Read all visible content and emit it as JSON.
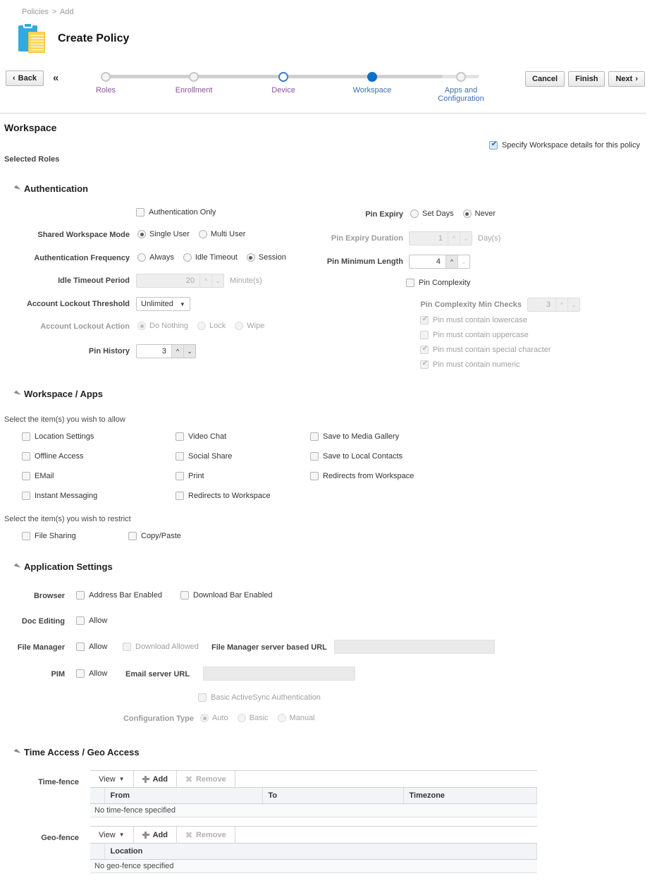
{
  "breadcrumb": {
    "root": "Policies",
    "separator": ">",
    "current": "Add"
  },
  "header": {
    "title": "Create Policy",
    "icon": "clipboard-document-icon"
  },
  "toolbar": {
    "back_label": "Back",
    "back_chevron": "‹",
    "collapse_icon": "«",
    "cancel_label": "Cancel",
    "finish_label": "Finish",
    "next_label": "Next",
    "next_chevron": "›"
  },
  "wizard": {
    "steps": [
      {
        "label": "Roles",
        "state": "done"
      },
      {
        "label": "Enrollment",
        "state": "done"
      },
      {
        "label": "Device",
        "state": "current"
      },
      {
        "label": "Workspace",
        "state": "active"
      },
      {
        "label": "Apps and\nConfiguration",
        "label_line1": "Apps and",
        "label_line2": "Configuration",
        "state": "todo"
      }
    ]
  },
  "page": {
    "section_title": "Workspace",
    "specify_label": "Specify Workspace details for this policy",
    "specify_checked": true,
    "selected_roles_label": "Selected Roles"
  },
  "authentication": {
    "heading": "Authentication",
    "auth_only": {
      "label": "Authentication Only",
      "checked": false
    },
    "shared_workspace_mode": {
      "label": "Shared Workspace Mode",
      "options": [
        "Single User",
        "Multi User"
      ],
      "selected": "Single User"
    },
    "auth_frequency": {
      "label": "Authentication Frequency",
      "options": [
        "Always",
        "Idle Timeout",
        "Session"
      ],
      "selected": "Session"
    },
    "idle_timeout_period": {
      "label": "Idle Timeout Period",
      "value": "20",
      "unit": "Minute(s)",
      "disabled": true
    },
    "account_lockout_threshold": {
      "label": "Account Lockout Threshold",
      "value": "Unlimited",
      "options": [
        "Unlimited"
      ]
    },
    "account_lockout_action": {
      "label": "Account Lockout Action",
      "options": [
        "Do Nothing",
        "Lock",
        "Wipe"
      ],
      "selected": "Do Nothing",
      "disabled": true
    },
    "pin_history": {
      "label": "Pin History",
      "value": "3"
    },
    "pin_expiry": {
      "label": "Pin Expiry",
      "options": [
        "Set Days",
        "Never"
      ],
      "selected": "Never"
    },
    "pin_expiry_duration": {
      "label": "Pin Expiry Duration",
      "value": "1",
      "unit": "Day(s)",
      "disabled": true
    },
    "pin_minimum_length": {
      "label": "Pin Minimum Length",
      "value": "4"
    },
    "pin_complexity": {
      "label": "Pin Complexity",
      "checked": false
    },
    "pin_complexity_min_checks": {
      "label": "Pin Complexity Min Checks",
      "value": "3",
      "disabled": true
    },
    "pin_rules": [
      {
        "label": "Pin must contain lowercase",
        "checked": true,
        "disabled": true
      },
      {
        "label": "Pin must contain uppercase",
        "checked": false,
        "disabled": true
      },
      {
        "label": "Pin must contain special character",
        "checked": true,
        "disabled": true
      },
      {
        "label": "Pin must contain numeric",
        "checked": true,
        "disabled": true
      }
    ]
  },
  "workspace_apps": {
    "heading": "Workspace / Apps",
    "allow_hint": "Select the item(s) you wish to allow",
    "allow_items": [
      {
        "label": "Location Settings",
        "checked": false
      },
      {
        "label": "Offline Access",
        "checked": false
      },
      {
        "label": "EMail",
        "checked": false
      },
      {
        "label": "Instant Messaging",
        "checked": false
      },
      {
        "label": "Video Chat",
        "checked": false
      },
      {
        "label": "Social Share",
        "checked": false
      },
      {
        "label": "Print",
        "checked": false
      },
      {
        "label": "Redirects to Workspace",
        "checked": false
      },
      {
        "label": "Save to Media Gallery",
        "checked": false
      },
      {
        "label": "Save to Local Contacts",
        "checked": false
      },
      {
        "label": "Redirects from Workspace",
        "checked": false
      }
    ],
    "restrict_hint": "Select the item(s) you wish to restrict",
    "restrict_items": [
      {
        "label": "File Sharing",
        "checked": false
      },
      {
        "label": "Copy/Paste",
        "checked": false
      }
    ]
  },
  "application_settings": {
    "heading": "Application Settings",
    "browser": {
      "label": "Browser",
      "address_bar": {
        "label": "Address Bar Enabled",
        "checked": false
      },
      "download_bar": {
        "label": "Download Bar Enabled",
        "checked": false
      }
    },
    "doc_editing": {
      "label": "Doc Editing",
      "allow_label": "Allow",
      "checked": false
    },
    "file_manager": {
      "label": "File Manager",
      "allow_label": "Allow",
      "allow_checked": false,
      "download_allowed_label": "Download Allowed",
      "download_allowed_checked": false,
      "download_allowed_disabled": true,
      "url_label": "File Manager server based URL",
      "url_value": ""
    },
    "pim": {
      "label": "PIM",
      "allow_label": "Allow",
      "allow_checked": false,
      "email_url_label": "Email server URL",
      "email_url_value": "",
      "basic_activesync_label": "Basic ActiveSync Authentication",
      "basic_activesync_checked": false,
      "basic_activesync_disabled": true,
      "config_type_label": "Configuration Type",
      "config_type_options": [
        "Auto",
        "Basic",
        "Manual"
      ],
      "config_type_selected": "Auto",
      "config_type_disabled": true
    }
  },
  "time_geo": {
    "heading": "Time Access / Geo Access",
    "time_fence": {
      "label": "Time-fence",
      "toolbar": {
        "view": "View",
        "add": "Add",
        "remove": "Remove"
      },
      "columns": [
        "From",
        "To",
        "Timezone"
      ],
      "empty_message": "No time-fence specified",
      "rows": []
    },
    "geo_fence": {
      "label": "Geo-fence",
      "toolbar": {
        "view": "View",
        "add": "Add",
        "remove": "Remove"
      },
      "columns": [
        "Location"
      ],
      "empty_message": "No geo-fence specified",
      "rows": []
    }
  },
  "colors": {
    "accent": "#1071c5",
    "step_current": "#3a7fd5",
    "link": "#3a6fb5",
    "visited": "#8b4f9c",
    "icon_blue": "#31aade",
    "icon_yellow": "#fcd663"
  }
}
